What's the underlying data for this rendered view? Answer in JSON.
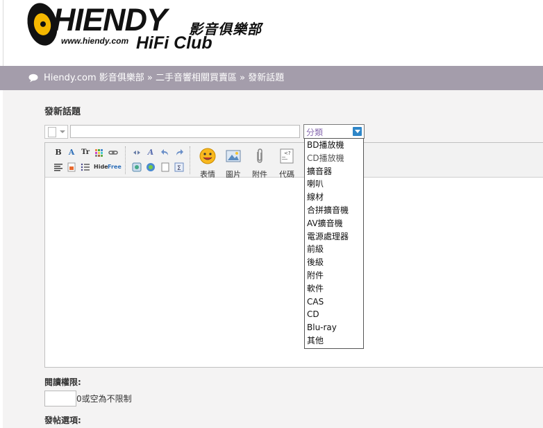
{
  "logo": {
    "brand": "HIENDY",
    "chinese": "影音俱樂部",
    "url": "www.hiendy.com",
    "tagline": "HiFi Club"
  },
  "breadcrumb": {
    "site": "Hiendy.com 影音俱樂部",
    "sep1": " » ",
    "forum": "二手音響相關買賣區",
    "sep2": " » ",
    "current": "發新話題"
  },
  "page_title": "發新話題",
  "subject": {
    "value": ""
  },
  "category": {
    "selected": "分類",
    "options": [
      "BD播放機",
      "CD播放機",
      "擴音器",
      "喇叭",
      "線材",
      "合拼擴音機",
      "AV擴音機",
      "電源處理器",
      "前級",
      "後級",
      "附件",
      "軟件",
      "CAS",
      "CD",
      "Blu-ray",
      "其他"
    ]
  },
  "toolbar": {
    "emoticon_label": "表情",
    "image_label": "圖片",
    "attach_label": "附件",
    "code_label": "代碼"
  },
  "read_permission": {
    "label": "閱讀權限:",
    "value": "",
    "hint": "0或空為不限制"
  },
  "post_options_label": "發帖選項:",
  "colors": {
    "nav_bg": "#a49dab",
    "content_bg": "#f4f3f3",
    "accent_blue": "#2e86c8",
    "category_text": "#8a6db1"
  }
}
